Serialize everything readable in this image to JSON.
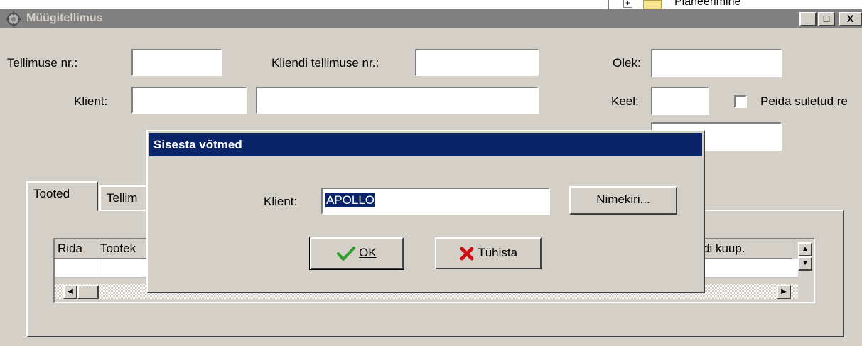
{
  "background_window": {
    "tree_item_label": "Planeerimine"
  },
  "main_window": {
    "title": "Müügitellimus",
    "controls": {
      "minimize": "_",
      "maximize": "□",
      "close": "X"
    },
    "fields": {
      "order_no_label": "Tellimuse nr.:",
      "order_no_value": "",
      "client_order_no_label": "Kliendi tellimuse nr.:",
      "client_order_no_value": "",
      "status_label": "Olek:",
      "status_value": "",
      "client_label": "Klient:",
      "client_code_value": "",
      "client_name_value": "",
      "language_label": "Keel:",
      "language_value": "",
      "hide_closed_label": "Peida suletud re",
      "hide_closed_checked": false,
      "third_row_value": ""
    },
    "tabs": [
      {
        "label": "Tooted",
        "active": true
      },
      {
        "label": "Tellim",
        "active": false
      }
    ],
    "grid": {
      "columns": [
        "Rida",
        "Tootek",
        "di kuup."
      ]
    }
  },
  "dialog": {
    "title": "Sisesta võtmed",
    "client_label": "Klient:",
    "client_value": "APOLLO",
    "list_button": "Nimekiri...",
    "ok_button": "OK",
    "cancel_button": "Tühista"
  },
  "colors": {
    "dialog_title_bg": "#0a246a",
    "inactive_title_bg": "#808080",
    "face": "#d4d0c8",
    "ok_check": "#2e9e2e",
    "cancel_x": "#d01010"
  }
}
